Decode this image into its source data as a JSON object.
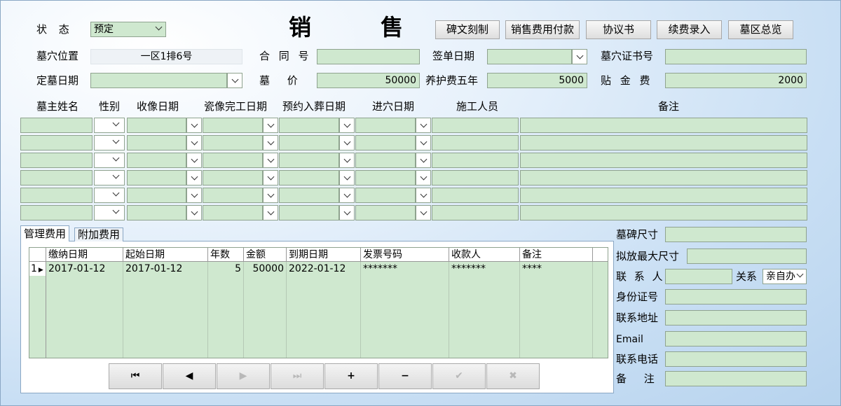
{
  "title": "销   售",
  "status": {
    "label": "状  态",
    "value": "预定"
  },
  "buttons": [
    "碑文刻制",
    "销售费用付款",
    "协议书",
    "续费录入",
    "墓区总览"
  ],
  "grave_location": {
    "label": "墓穴位置",
    "value": "一区1排6号"
  },
  "contract_no": {
    "label": "合 同 号",
    "value": ""
  },
  "sign_date": {
    "label": "签单日期",
    "value": ""
  },
  "cert_no": {
    "label": "墓穴证书号",
    "value": ""
  },
  "order_date": {
    "label": "定墓日期",
    "value": ""
  },
  "grave_price": {
    "label": "墓  价",
    "value": "50000"
  },
  "maintenance_fee": {
    "label": "养护费五年",
    "value": "5000"
  },
  "gold_fee": {
    "label": "贴 金 费",
    "value": "2000"
  },
  "occupant_headers": [
    "墓主姓名",
    "性别",
    "收像日期",
    "瓷像完工日期",
    "预约入葬日期",
    "进穴日期",
    "施工人员",
    "备注"
  ],
  "tabs": [
    "管理费用",
    "附加费用"
  ],
  "fee_table": {
    "headers": [
      "缴纳日期",
      "起始日期",
      "年数",
      "金额",
      "到期日期",
      "发票号码",
      "收款人",
      "备注"
    ],
    "rows": [
      {
        "num": "1",
        "cells": [
          "2017-01-12",
          "2017-01-12",
          "5",
          "50000",
          "2022-01-12",
          "*******",
          "*******",
          "****"
        ]
      }
    ]
  },
  "nav_buttons": [
    "⏮",
    "◀",
    "▶",
    "⏭",
    "+",
    "−",
    "✔",
    "✖"
  ],
  "right_panel": {
    "tombstone_size": "墓碑尺寸",
    "max_size": "拟放最大尺寸",
    "contact": "联 系 人",
    "relation_label": "关系",
    "relation_value": "亲自办",
    "id_no": "身份证号",
    "address": "联系地址",
    "email": "Email",
    "phone": "联系电话",
    "remark": "备  注"
  },
  "colors": {
    "field": "#cfe8cf",
    "accent": "#8aa7c4"
  }
}
